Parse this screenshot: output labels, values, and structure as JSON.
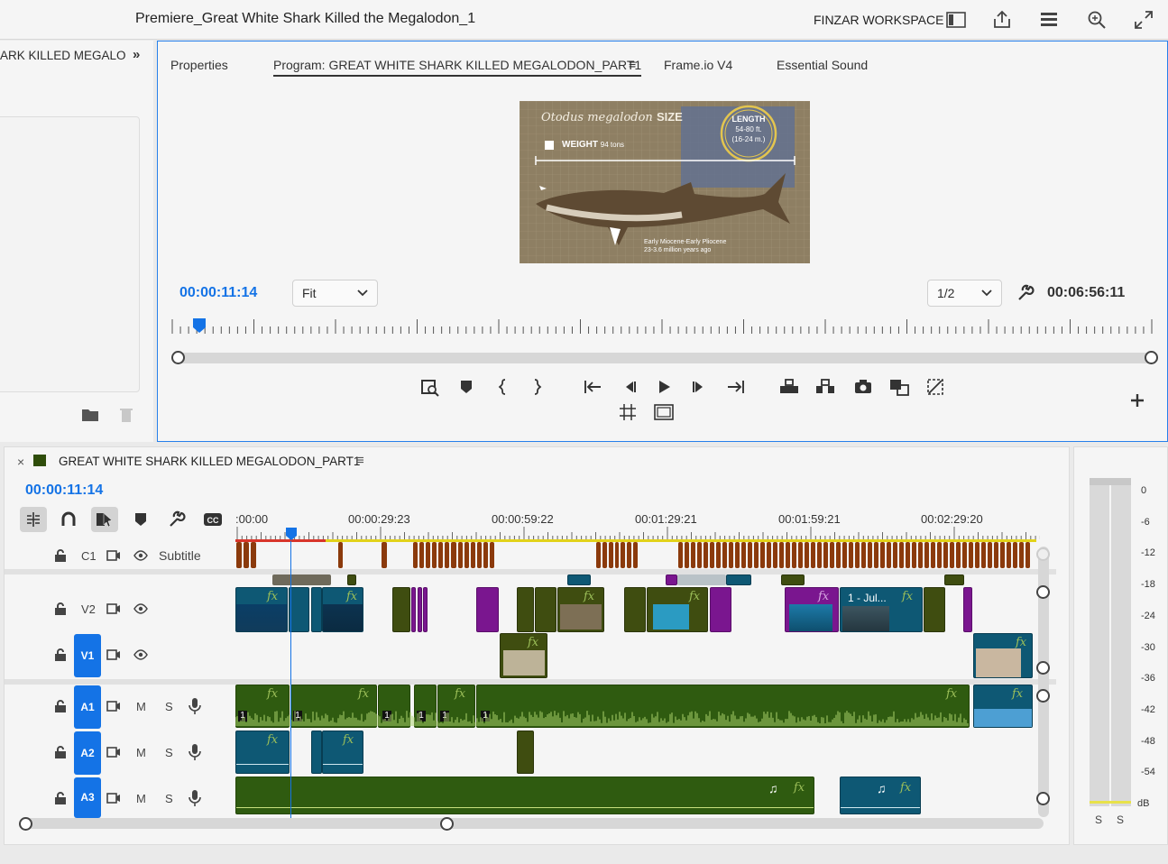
{
  "header": {
    "doc_title": "Premiere_Great White Shark Killed the Megalodon_1",
    "workspace": "FINZAR WORKSPACE"
  },
  "left_panel": {
    "title": "ARK KILLED MEGALOD",
    "expand": "»"
  },
  "monitor": {
    "tabs": [
      "Properties",
      "Program: GREAT WHITE SHARK KILLED MEGALODON_PART1",
      "Frame.io V4",
      "Essential Sound"
    ],
    "tab_menu": "≡",
    "preview": {
      "title": "Otodus megalodon",
      "title_strong": "SIZE",
      "weight_label": "WEIGHT",
      "weight_value": "94 tons",
      "length_label": "LENGTH",
      "length_ft": "54-80 ft.",
      "length_m": "(16-24 m.)",
      "era_line1": "Early Miocene-Early Pliocene",
      "era_line2": "23-3.6 million years ago"
    },
    "current_time": "00:00:11:14",
    "zoom": "Fit",
    "resolution": "1/2",
    "duration": "00:06:56:11",
    "playhead_fraction": 0.016
  },
  "timeline": {
    "sequence_name": "GREAT WHITE SHARK KILLED MEGALODON_PART1",
    "close": "×",
    "menu": "≡",
    "current_time": "00:00:11:14",
    "ruler": [
      ":00:00",
      "00:00:29:23",
      "00:00:59:22",
      "00:01:29:21",
      "00:01:59:21",
      "00:02:29:20"
    ],
    "tracks": {
      "c1": {
        "id": "C1",
        "name": "Subtitle"
      },
      "v2": {
        "id": "V2"
      },
      "v1": {
        "id": "V1"
      },
      "a1": {
        "id": "A1",
        "m": "M",
        "s": "S"
      },
      "a2": {
        "id": "A2",
        "m": "M",
        "s": "S"
      },
      "a3": {
        "id": "A3",
        "m": "M",
        "s": "S"
      }
    },
    "clip_labels": {
      "fx": "fx",
      "jul_clip": "1 - Jul...",
      "audio_ch": "1"
    }
  },
  "meter": {
    "scale": [
      "0",
      "-6",
      "-12",
      "-18",
      "-24",
      "-30",
      "-36",
      "-42",
      "-48",
      "-54",
      "dB"
    ],
    "solo_left": "S",
    "solo_right": "S"
  },
  "colors": {
    "accent": "#1473e6",
    "video_clip_olive": "#3f4d10",
    "video_clip_purple": "#7a168f",
    "video_clip_teal": "#0e5874",
    "audio_clip_green": "#2f5b10",
    "caption_clip": "#8b3a0c"
  }
}
